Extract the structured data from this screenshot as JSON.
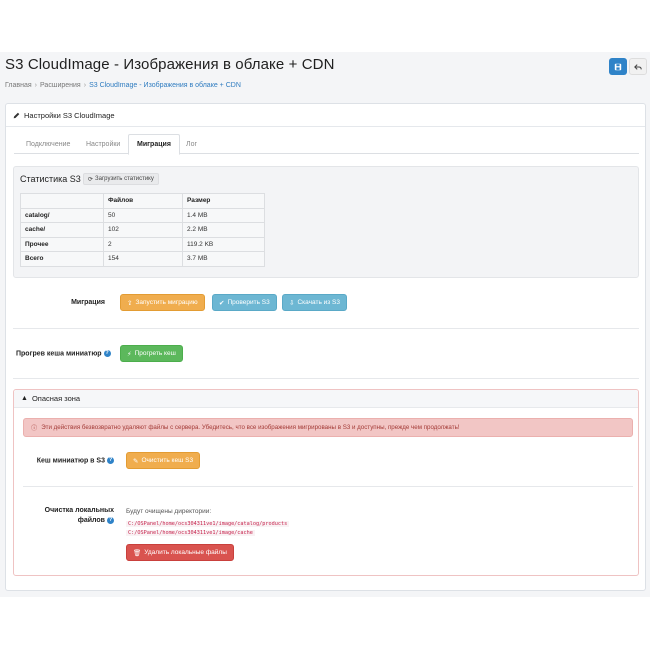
{
  "header": {
    "title": "S3 CloudImage - Изображения в облаке + CDN",
    "breadcrumb": [
      "Главная",
      "Расширения",
      "S3 CloudImage - Изображения в облаке + CDN"
    ],
    "save_icon": "save-icon",
    "back_icon": "back-icon"
  },
  "card": {
    "title": "Настройки S3 CloudImage",
    "tabs": [
      "Подключение",
      "Настройки",
      "Миграция",
      "Лог"
    ],
    "active_tab": "Миграция"
  },
  "stats": {
    "title": "Статистика S3",
    "load_button": "Загрузить статистику",
    "columns": [
      "",
      "Файлов",
      "Размер"
    ],
    "rows": [
      {
        "label": "catalog/",
        "files": "50",
        "size": "1.4 MB"
      },
      {
        "label": "cache/",
        "files": "102",
        "size": "2.2 MB"
      },
      {
        "label": "Прочее",
        "files": "2",
        "size": "119.2 KB"
      },
      {
        "label": "Всего",
        "files": "154",
        "size": "3.7 MB"
      }
    ]
  },
  "migration": {
    "label": "Миграция",
    "start_button": "Запустить миграцию",
    "check_button": "Проверить S3",
    "download_button": "Скачать из S3"
  },
  "warmup": {
    "label": "Прогрев кеша миниатюр",
    "button": "Прогреть кеш"
  },
  "danger": {
    "title": "Опасная зона",
    "alert": "Эти действия безвозвратно удаляют файлы с сервера. Убедитесь, что все изображения мигрированы в S3 и доступны, прежде чем продолжать!",
    "cache_label": "Кеш миниатюр в S3",
    "cache_button": "Очистить кеш S3",
    "local_label_1": "Очистка локальных",
    "local_label_2": "файлов",
    "dirs_title": "Будут очищены директории:",
    "dirs": [
      "C:/OSPanel/home/ocs304311ve1/image/catalog/products",
      "C:/OSPanel/home/ocs304311ve1/image/cache"
    ],
    "delete_button": "Удалить локальные файлы"
  },
  "colors": {
    "primary": "#2f83c8",
    "warning": "#f0ad4e",
    "info": "#6db7d3",
    "success": "#5cb85c",
    "danger": "#d9534f"
  }
}
